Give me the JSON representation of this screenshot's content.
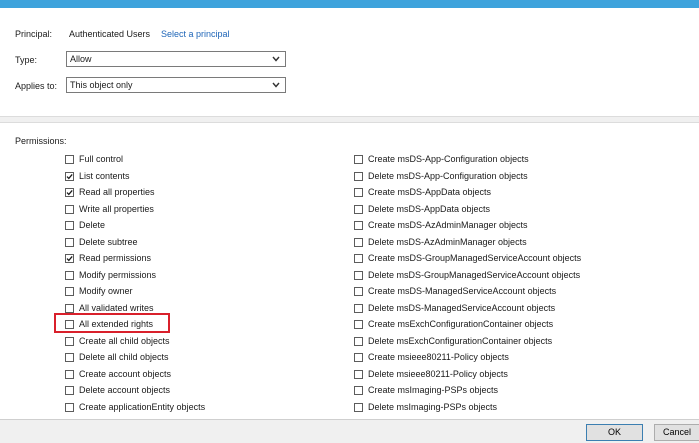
{
  "principal": {
    "label": "Principal:",
    "value": "Authenticated Users",
    "link": "Select a principal"
  },
  "type": {
    "label": "Type:",
    "selected": "Allow"
  },
  "applies_to": {
    "label": "Applies to:",
    "selected": "This object only"
  },
  "permissions": {
    "title": "Permissions:",
    "left": [
      {
        "label": "Full control",
        "checked": false
      },
      {
        "label": "List contents",
        "checked": true
      },
      {
        "label": "Read all properties",
        "checked": true
      },
      {
        "label": "Write all properties",
        "checked": false
      },
      {
        "label": "Delete",
        "checked": false
      },
      {
        "label": "Delete subtree",
        "checked": false
      },
      {
        "label": "Read permissions",
        "checked": true
      },
      {
        "label": "Modify permissions",
        "checked": false
      },
      {
        "label": "Modify owner",
        "checked": false
      },
      {
        "label": "All validated writes",
        "checked": false
      },
      {
        "label": "All extended rights",
        "checked": false
      },
      {
        "label": "Create all child objects",
        "checked": false
      },
      {
        "label": "Delete all child objects",
        "checked": false
      },
      {
        "label": "Create account objects",
        "checked": false
      },
      {
        "label": "Delete account objects",
        "checked": false
      },
      {
        "label": "Create applicationEntity objects",
        "checked": false
      }
    ],
    "right": [
      {
        "label": "Create msDS-App-Configuration objects",
        "checked": false
      },
      {
        "label": "Delete msDS-App-Configuration objects",
        "checked": false
      },
      {
        "label": "Create msDS-AppData objects",
        "checked": false
      },
      {
        "label": "Delete msDS-AppData objects",
        "checked": false
      },
      {
        "label": "Create msDS-AzAdminManager objects",
        "checked": false
      },
      {
        "label": "Delete msDS-AzAdminManager objects",
        "checked": false
      },
      {
        "label": "Create msDS-GroupManagedServiceAccount objects",
        "checked": false
      },
      {
        "label": "Delete msDS-GroupManagedServiceAccount objects",
        "checked": false
      },
      {
        "label": "Create msDS-ManagedServiceAccount objects",
        "checked": false
      },
      {
        "label": "Delete msDS-ManagedServiceAccount objects",
        "checked": false
      },
      {
        "label": "Create msExchConfigurationContainer objects",
        "checked": false
      },
      {
        "label": "Delete msExchConfigurationContainer objects",
        "checked": false
      },
      {
        "label": "Create msieee80211-Policy objects",
        "checked": false
      },
      {
        "label": "Delete msieee80211-Policy objects",
        "checked": false
      },
      {
        "label": "Create msImaging-PSPs objects",
        "checked": false
      },
      {
        "label": "Delete msImaging-PSPs objects",
        "checked": false
      }
    ]
  },
  "highlighted_permission": "All extended rights",
  "colors": {
    "title_bar": "#3ea3dc",
    "link": "#1f66b8",
    "highlight": "#d9202b"
  },
  "buttons": {
    "ok": "OK",
    "cancel": "Cancel"
  }
}
